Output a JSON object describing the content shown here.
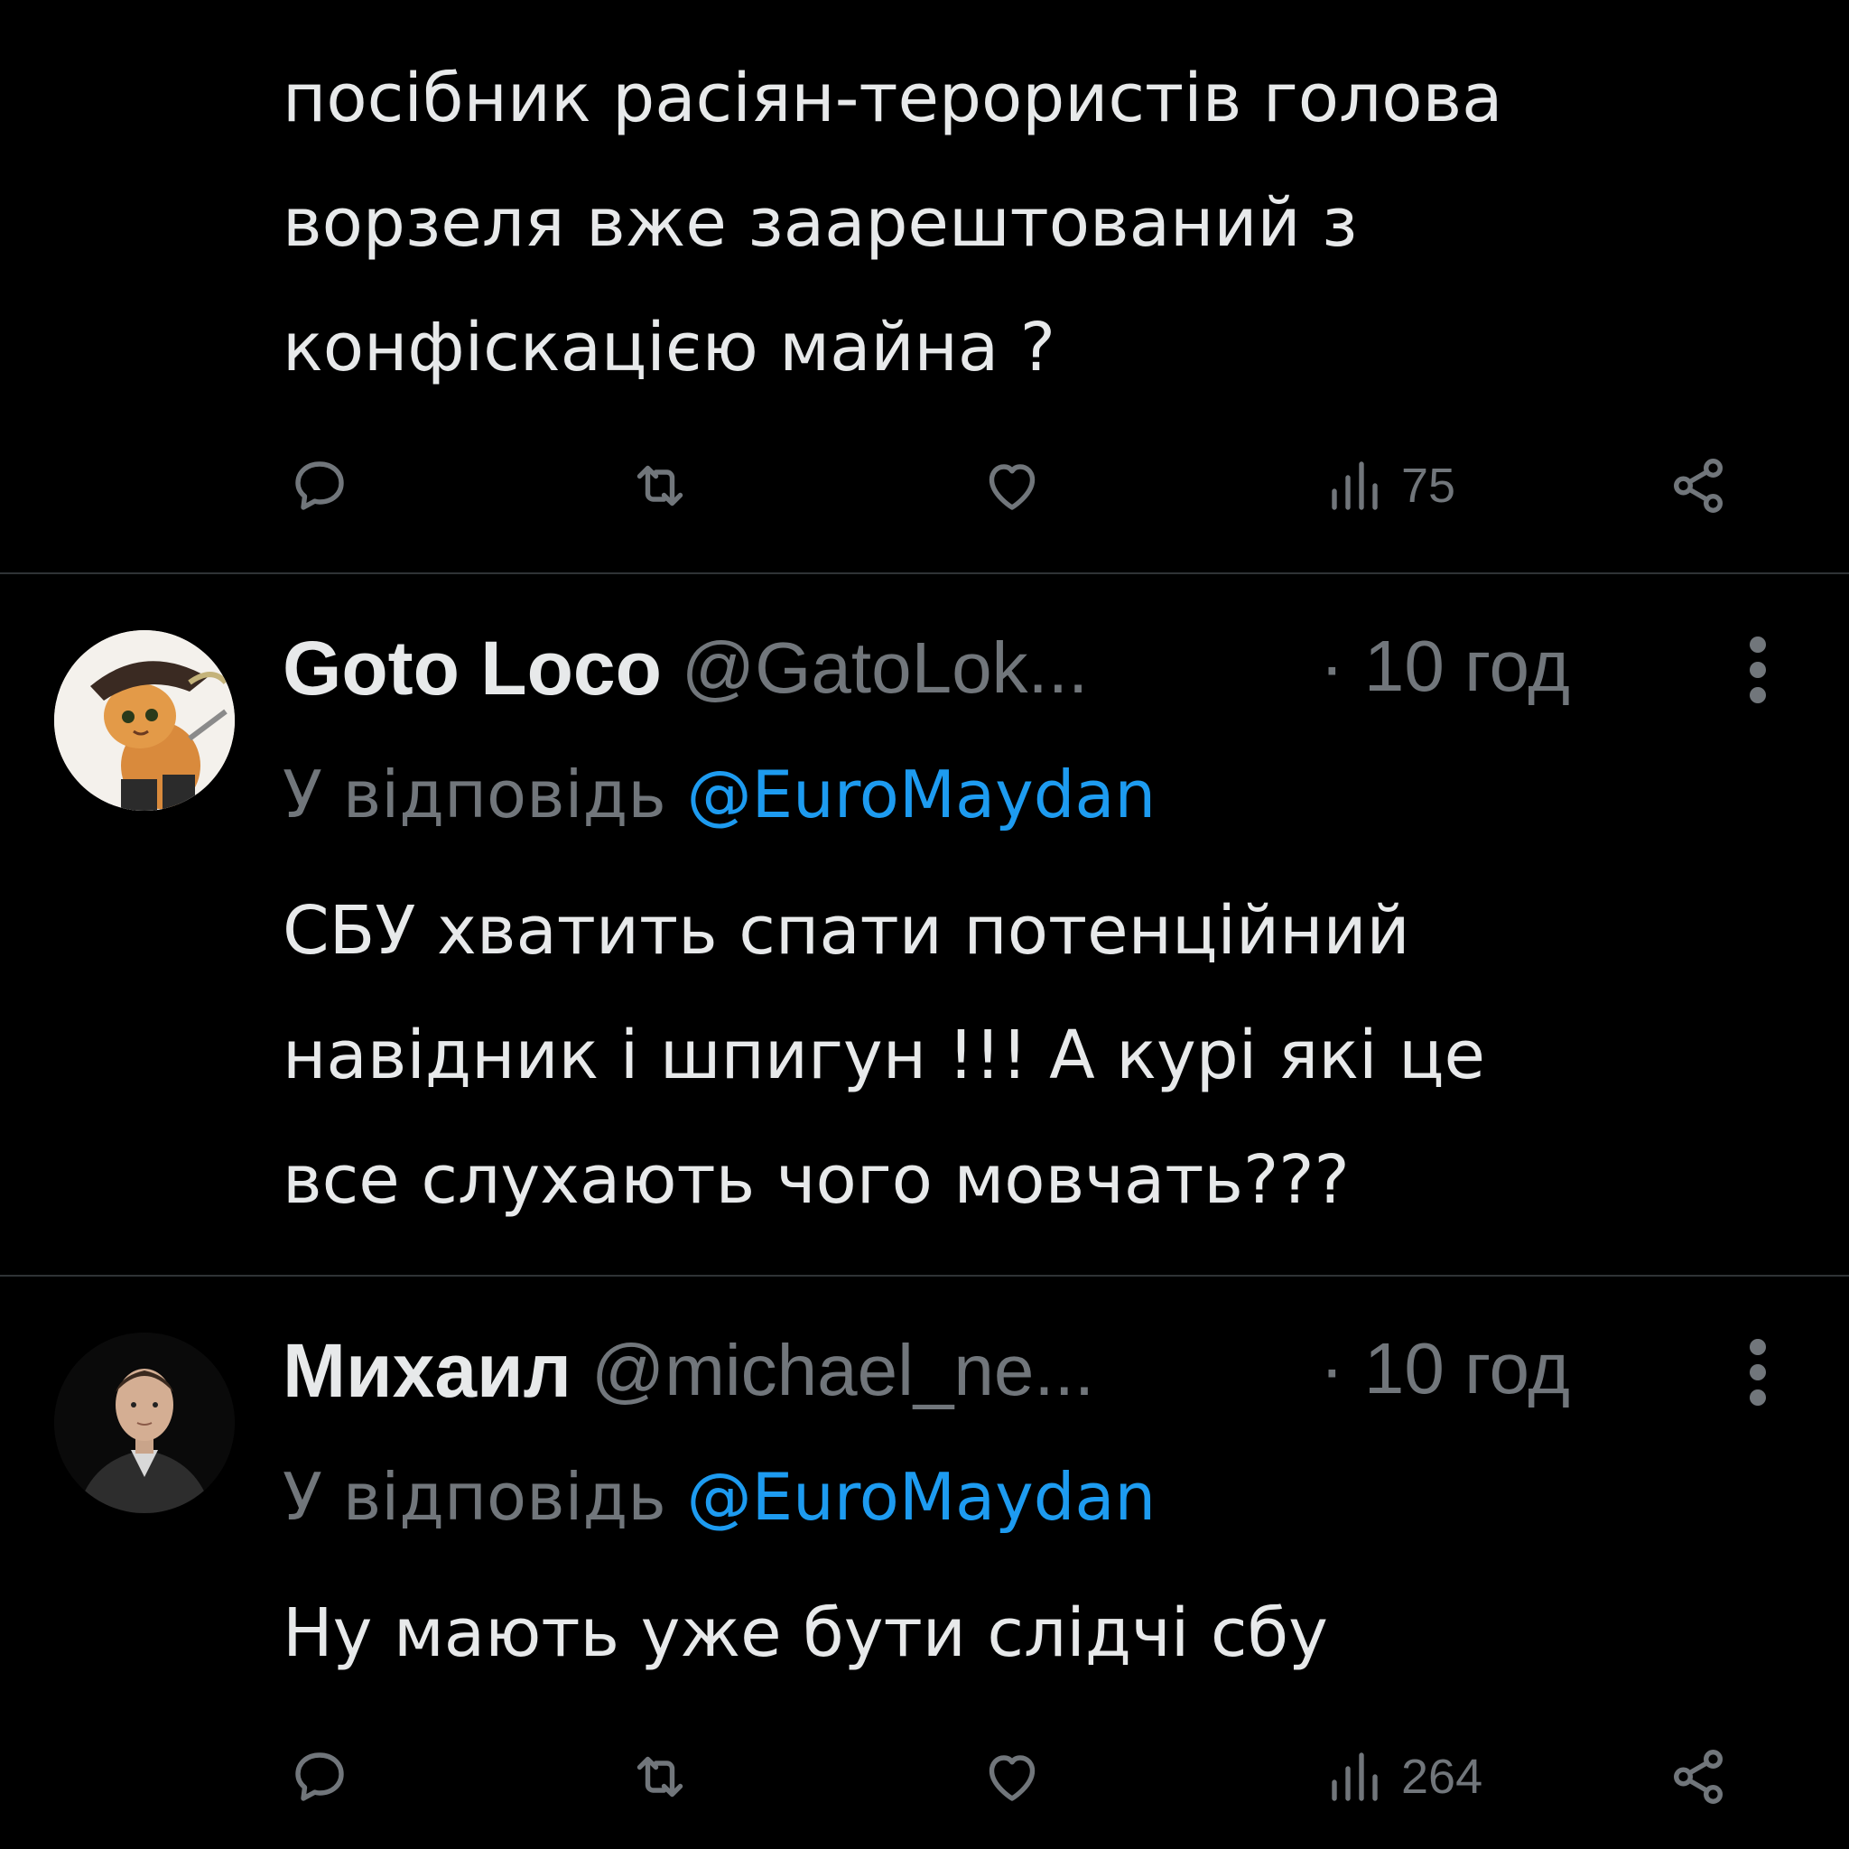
{
  "tweet1": {
    "text": "посібник расіян-терористів  голова\nворзеля вже заарештований з\nконфіскацією майна ?",
    "views": "75"
  },
  "tweet2": {
    "author_name": "Goto Loco",
    "author_handle": "@GatoLok...",
    "time": "· 10 год",
    "reply_prefix": "У відповідь",
    "reply_to": "@EuroMaydan",
    "text": "СБУ хватить спати потенційний\nнавідник і шпигун !!! А курі які це\nвсе слухають чого мовчать???"
  },
  "tweet3": {
    "author_name": "Михаил",
    "author_handle": "@michael_ne...",
    "time": "· 10 год",
    "reply_prefix": "У відповідь",
    "reply_to": "@EuroMaydan",
    "text": "Ну мають уже бути слідчі сбу",
    "views": "264"
  },
  "colors": {
    "background": "#000000",
    "text": "#e7e9ea",
    "secondary": "#71767b",
    "link": "#1d9bf0",
    "divider": "#2f3336"
  }
}
